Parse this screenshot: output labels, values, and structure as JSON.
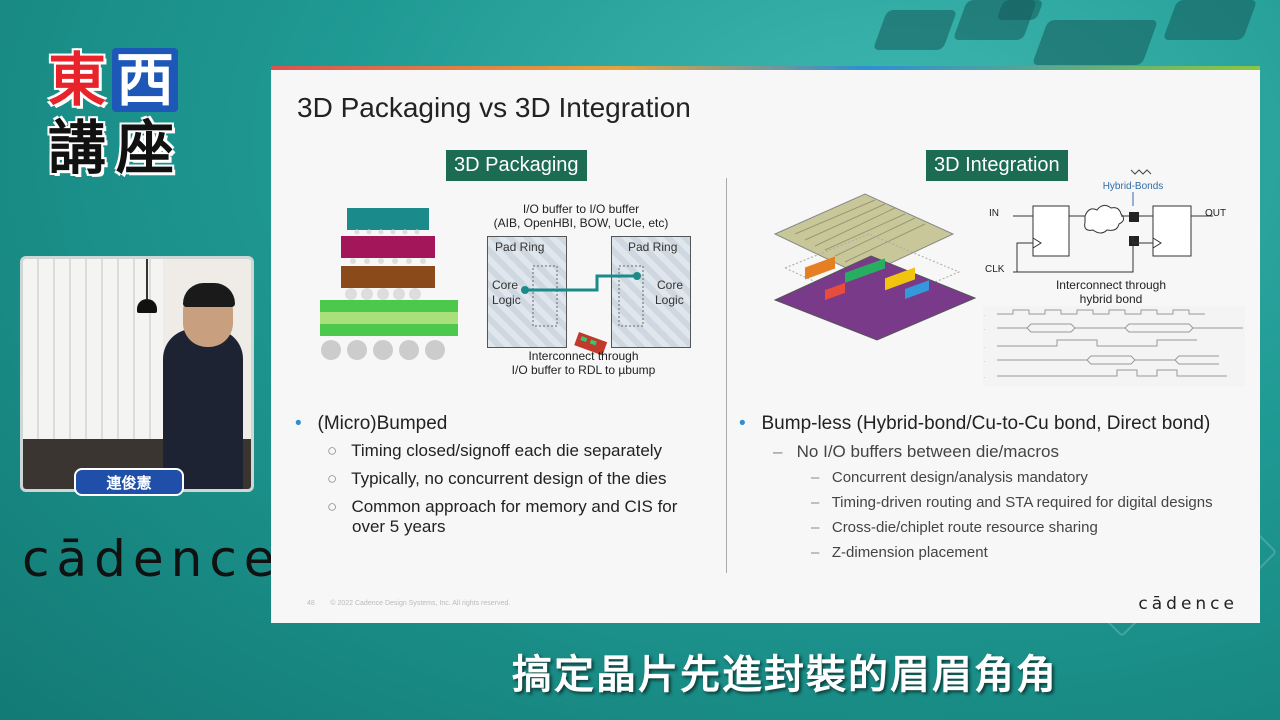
{
  "logo": {
    "chars": [
      "東",
      "西",
      "講",
      "座"
    ]
  },
  "speaker": {
    "name": "連俊憲"
  },
  "brand": {
    "text": "cādence"
  },
  "slide": {
    "title": "3D Packaging vs 3D Integration",
    "left_header": "3D Packaging",
    "right_header": "3D Integration",
    "left_diagram": {
      "top_label_1": "I/O buffer to I/O buffer",
      "top_label_2": "(AIB, OpenHBI, BOW, UCIe, etc)",
      "pad_ring": "Pad Ring",
      "core": "Core",
      "logic": "Logic",
      "bottom_label_1": "Interconnect through",
      "bottom_label_2": "I/O buffer to RDL to µbump"
    },
    "right_diagram": {
      "hybrid_bonds": "Hybrid-Bonds",
      "in": "IN",
      "out": "OUT",
      "clk": "CLK",
      "caption_1": "Interconnect through",
      "caption_2": "hybrid bond"
    },
    "left_bullets": {
      "main": "(Micro)Bumped",
      "subs": [
        "Timing closed/signoff each die separately",
        "Typically, no concurrent design of the dies",
        "Common approach for memory and CIS for",
        "over 5 years"
      ]
    },
    "right_bullets": {
      "main": "Bump-less (Hybrid-bond/Cu-to-Cu bond, Direct bond)",
      "sub": "No I/O buffers between die/macros",
      "subsubs": [
        "Concurrent design/analysis mandatory",
        "Timing-driven routing and STA required for digital designs",
        "Cross-die/chiplet route resource sharing",
        "Z-dimension placement"
      ]
    },
    "footer": {
      "page": "48",
      "copyright": "© 2022 Cadence Design Systems, Inc. All rights reserved."
    },
    "brand": "cādence"
  },
  "subtitle": "搞定晶片先進封裝的眉眉角角",
  "colors": {
    "header_green": "#1c6c54",
    "bullet_blue": "#2d8fd2",
    "logo_red": "#e8242a",
    "logo_blue": "#1d57b7"
  }
}
